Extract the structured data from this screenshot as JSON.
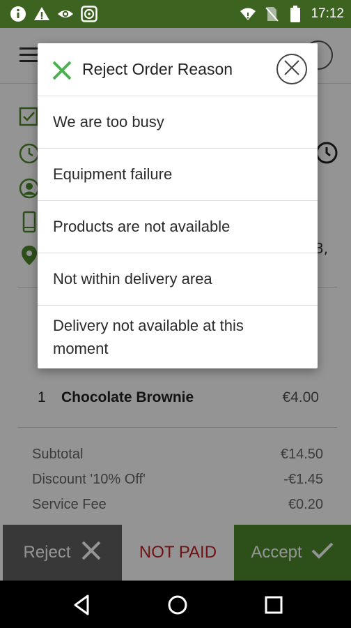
{
  "status_bar": {
    "time": "17:12",
    "bg_color": "#3d6320",
    "left_icons": [
      "info-icon",
      "warning-icon",
      "eye-icon",
      "steering-icon"
    ],
    "right_icons": [
      "wifi-icon",
      "no-sim-icon",
      "battery-icon"
    ]
  },
  "dialog": {
    "title": "Reject Order Reason",
    "accent_color": "#4caf50",
    "reasons": [
      {
        "label": "We are too busy"
      },
      {
        "label": "Equipment failure"
      },
      {
        "label": "Products are not available"
      },
      {
        "label": "Not within delivery area"
      },
      {
        "label": "Delivery not available at this moment"
      }
    ]
  },
  "background": {
    "address_tail": "3,",
    "item": {
      "qty": "1",
      "name": "Chocolate Brownie",
      "price": "€4.00"
    },
    "totals": [
      {
        "label": "Subtotal",
        "value": "€14.50"
      },
      {
        "label": "Discount '10% Off'",
        "value": "-€1.45"
      },
      {
        "label": "Service Fee",
        "value": "€0.20"
      }
    ],
    "colors": {
      "green": "#4f8a2e",
      "status_red": "#c41e24"
    }
  },
  "action_bar": {
    "reject_label": "Reject",
    "status_label": "NOT PAID",
    "accept_label": "Accept"
  }
}
